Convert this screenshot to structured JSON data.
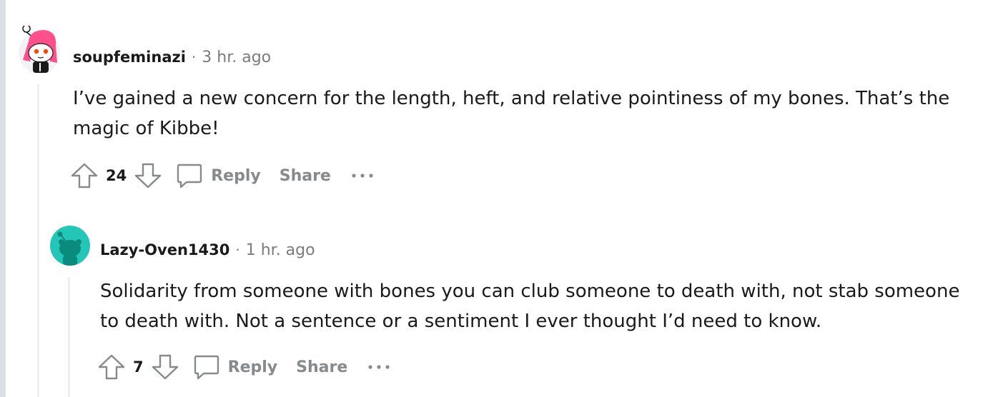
{
  "comments": [
    {
      "author": "soupfeminazi",
      "separator": "·",
      "time": "3 hr. ago",
      "body_line1": "I’ve gained a new concern for the length, heft, and relative pointiness of my bones. That’s the",
      "body_line2": "magic of Kibbe!",
      "score": "24",
      "reply_label": "Reply",
      "share_label": "Share",
      "avatar_icon": "snoo-avatar-icon"
    },
    {
      "author": "Lazy-Oven1430",
      "separator": "·",
      "time": "1 hr. ago",
      "body_line1": "Solidarity from someone with bones you can club someone to death with, not stab someone",
      "body_line2": "to death with. Not a sentence or a sentiment I ever thought I’d need to know.",
      "score": "7",
      "reply_label": "Reply",
      "share_label": "Share",
      "avatar_icon": "default-snoo-avatar-icon"
    }
  ],
  "colors": {
    "text": "#1a1a1b",
    "muted": "#878a8c",
    "thread_line": "#edeff1",
    "teal_avatar": "#24c7b7",
    "pink_hair": "#ff4f8b"
  }
}
